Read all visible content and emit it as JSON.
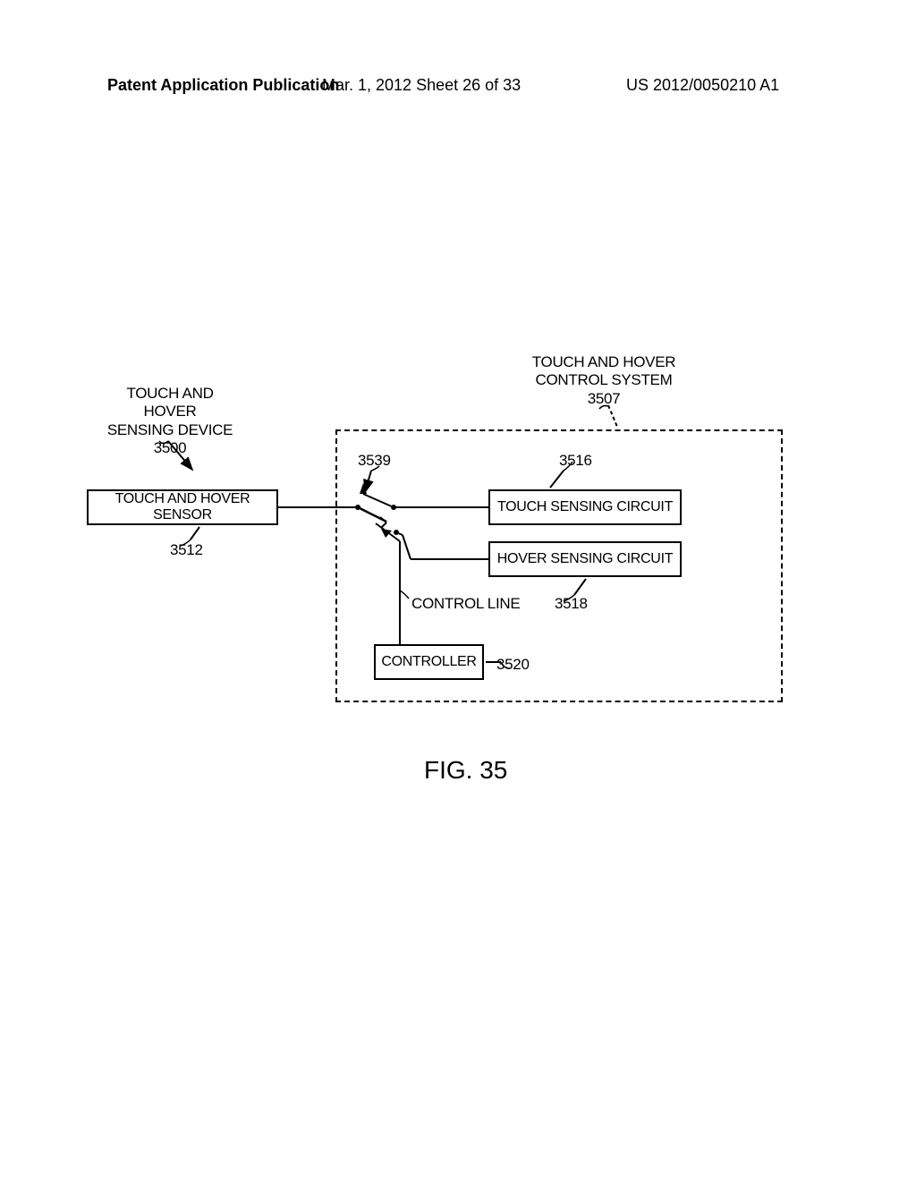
{
  "header": {
    "left": "Patent Application Publication",
    "center": "Mar. 1, 2012  Sheet 26 of 33",
    "right": "US 2012/0050210 A1"
  },
  "labels": {
    "sensing_device_line1": "TOUCH AND HOVER",
    "sensing_device_line2": "SENSING DEVICE",
    "sensing_device_ref": "3500",
    "control_system_line1": "TOUCH AND HOVER",
    "control_system_line2": "CONTROL SYSTEM",
    "control_system_ref": "3507",
    "switch_ref": "3539",
    "touch_circuit_ref": "3516",
    "sensor_ref": "3512",
    "hover_circuit_ref": "3518",
    "controller_ref": "3520",
    "control_line": "CONTROL LINE"
  },
  "boxes": {
    "sensor": "TOUCH AND HOVER SENSOR",
    "touch_circuit": "TOUCH SENSING CIRCUIT",
    "hover_circuit": "HOVER SENSING CIRCUIT",
    "controller": "CONTROLLER"
  },
  "figure_caption": "FIG. 35"
}
